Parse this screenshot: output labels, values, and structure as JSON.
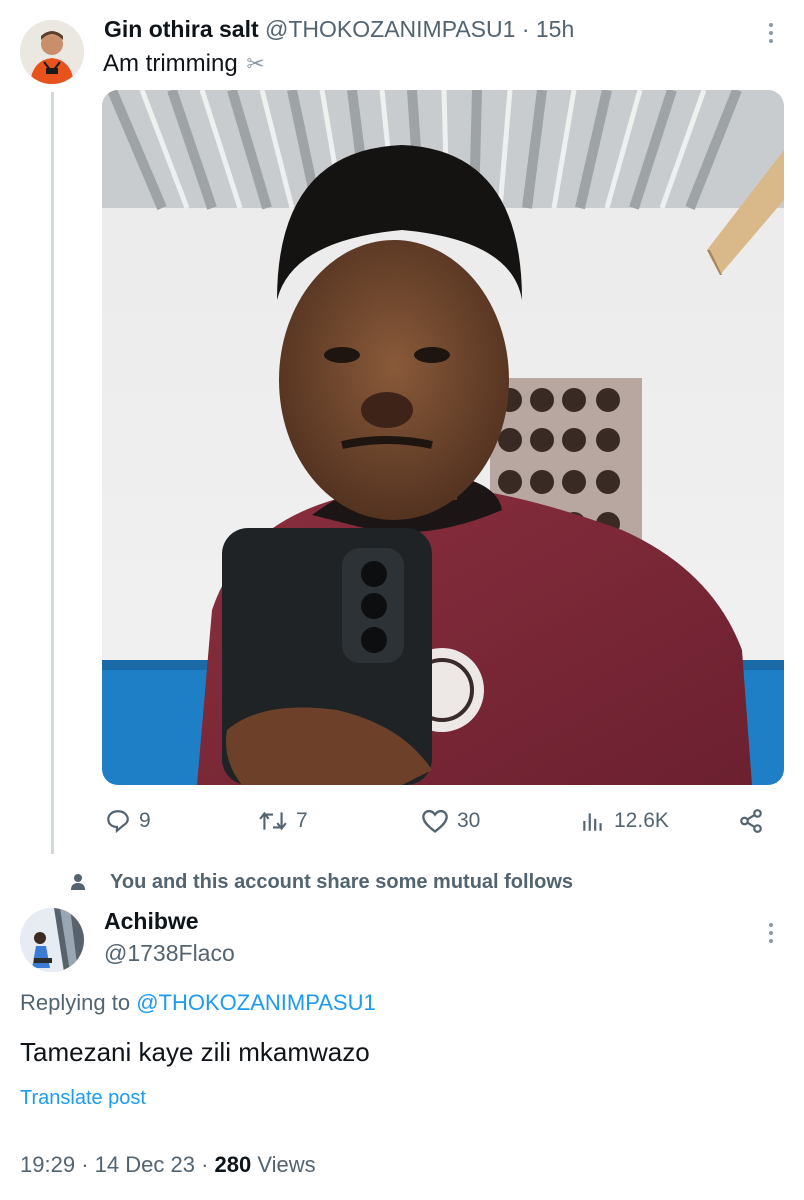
{
  "tweet": {
    "author_name": "Gin othira salt",
    "handle": "@THOKOZANIMPASU1",
    "separator": "·",
    "time": "15h",
    "text": "Am trimming",
    "emoji_icon": "scissors-icon",
    "photo_alt": "selfie-in-barbershop-mirror",
    "actions": {
      "replies": "9",
      "reposts": "7",
      "likes": "30",
      "views": "12.6K"
    }
  },
  "mutual_notice": "You and this account share some mutual follows",
  "reply": {
    "author_name": "Achibwe",
    "handle": "@1738Flaco",
    "replying_prefix": "Replying to",
    "replying_to": "@THOKOZANIMPASU1",
    "text": "Tamezani kaye zili mkamwazo",
    "translate_label": "Translate post",
    "time": "19:29",
    "date": "14 Dec 23",
    "separator": "·",
    "views_count": "280",
    "views_label": "Views"
  },
  "colors": {
    "text_primary": "#0f1419",
    "text_secondary": "#536471",
    "link": "#1d9bf0",
    "thread_line": "#cfd9de"
  }
}
